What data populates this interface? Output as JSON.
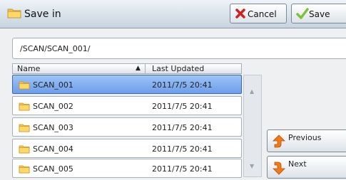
{
  "dialog": {
    "title": "Save in",
    "cancel_label": "Cancel",
    "save_label": "Save"
  },
  "path": "/SCAN/SCAN_001/",
  "list": {
    "columns": {
      "name": "Name",
      "last_updated": "Last Updated"
    },
    "sort_indicator": "▲",
    "items": [
      {
        "name": "SCAN_001",
        "date": "2011/7/5 20:41",
        "selected": true
      },
      {
        "name": "SCAN_002",
        "date": "2011/7/5 20:41"
      },
      {
        "name": "SCAN_003",
        "date": "2011/7/5 20:41"
      },
      {
        "name": "SCAN_004",
        "date": "2011/7/5 20:41"
      },
      {
        "name": "SCAN_005",
        "date": "2011/7/5 20:41"
      }
    ]
  },
  "scroll": {
    "up": "▲",
    "down": "▼"
  },
  "nav": {
    "previous_label": "Previous",
    "next_label": "Next"
  },
  "icons": {
    "folder": "folder-icon",
    "cancel": "cancel-x-icon",
    "save": "checkmark-icon",
    "previous": "arrow-up-icon",
    "next": "arrow-down-icon"
  },
  "colors": {
    "selected_row": "#7fa9ee",
    "cancel_x": "#d22020",
    "save_check": "#7cc23c",
    "nav_arrow": "#f07a18",
    "folder": "#f5c64a"
  }
}
